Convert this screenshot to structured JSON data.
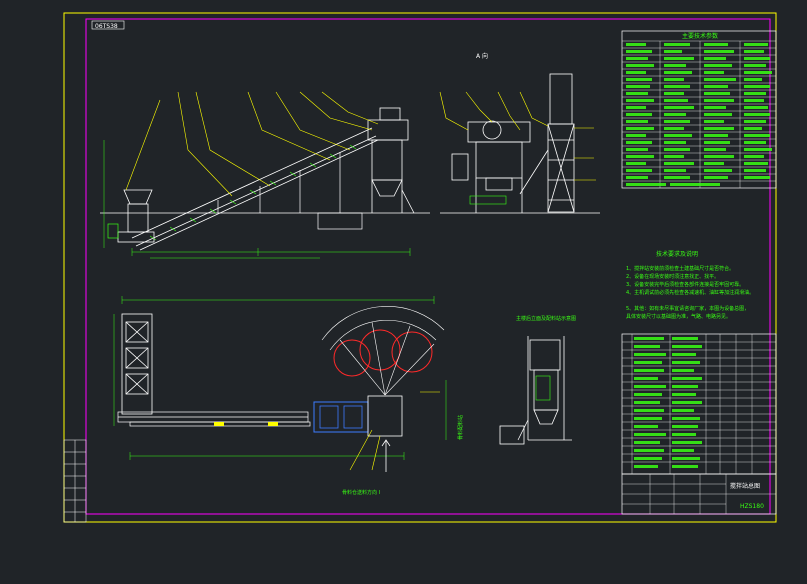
{
  "drawing": {
    "corner_tag": "06TS38",
    "view_a_label": "A 向",
    "tech_params_title": "主要技术参数",
    "notes_title": "技术要求及说明",
    "notes": [
      "1、搅拌站安装前须检查土建基础尺寸是否符合。",
      "2、设备在现场安装时须注意找正、找平。",
      "3、设备安装完毕后须检查各部件连接是否牢固可靠。",
      "4、主机调试前必须先检查各减速机、油缸等加注润滑油。",
      "5、其他：如有未尽事宜请咨询厂家，本图为设备总图，",
      "   具体安装尺寸以基础图为准，气路、电路另见。"
    ],
    "side_view_title": "主楼后立面及配料站示意图",
    "plan_arrow_label": "骨料仓送料方向 I",
    "plan_side_label": "骨料配料站",
    "title_block_name": "搅拌站总图",
    "drawing_number": "HZS180",
    "colors": {
      "background": "#202428",
      "frame": "#ffff00",
      "inner_frame": "#ff00ff",
      "equipment": "#ffffff",
      "dimension": "#39ff14",
      "leader": "#ffff00",
      "accent_red": "#ff2a2a",
      "accent_blue": "#3d7bff"
    }
  }
}
